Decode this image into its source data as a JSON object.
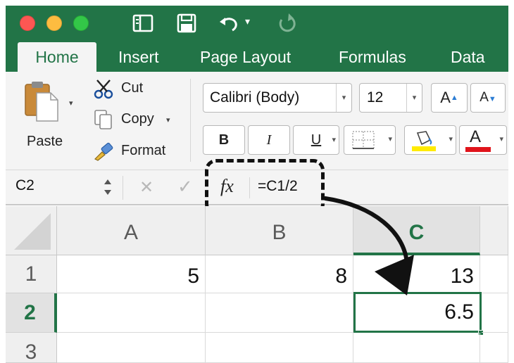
{
  "window": {
    "controls": [
      "close",
      "minimize",
      "zoom"
    ],
    "quick_access_icons": [
      "sidebar-icon",
      "save-icon",
      "undo-icon",
      "redo-icon"
    ],
    "undo_dropdown": "▾"
  },
  "tabs": [
    "Home",
    "Insert",
    "Page Layout",
    "Formulas",
    "Data"
  ],
  "ribbon": {
    "paste_label": "Paste",
    "cut_label": "Cut",
    "copy_label": "Copy",
    "format_label": "Format",
    "font_name": "Calibri (Body)",
    "font_size": "12",
    "grow_font": "A",
    "shrink_font": "A",
    "bold": "B",
    "italic": "I",
    "underline": "U",
    "font_color_letter": "A",
    "dropdown_glyph": "▾"
  },
  "formula_bar": {
    "name_box": "C2",
    "cancel_glyph": "✕",
    "confirm_glyph": "✓",
    "fx_label": "fx",
    "formula": "=C1/2"
  },
  "sheet": {
    "columns": [
      "A",
      "B",
      "C"
    ],
    "rows": [
      "1",
      "2",
      "3"
    ],
    "selected_cell": "C2",
    "cells": {
      "A1": "5",
      "B1": "8",
      "C1": "13",
      "C2": "6.5"
    }
  },
  "colors": {
    "excel_green": "#227447",
    "ribbon_bg": "#f4f4f4",
    "highlight_yellow": "#ffeb00",
    "font_red": "#e0141b",
    "accent_blue": "#2b7cd3"
  }
}
